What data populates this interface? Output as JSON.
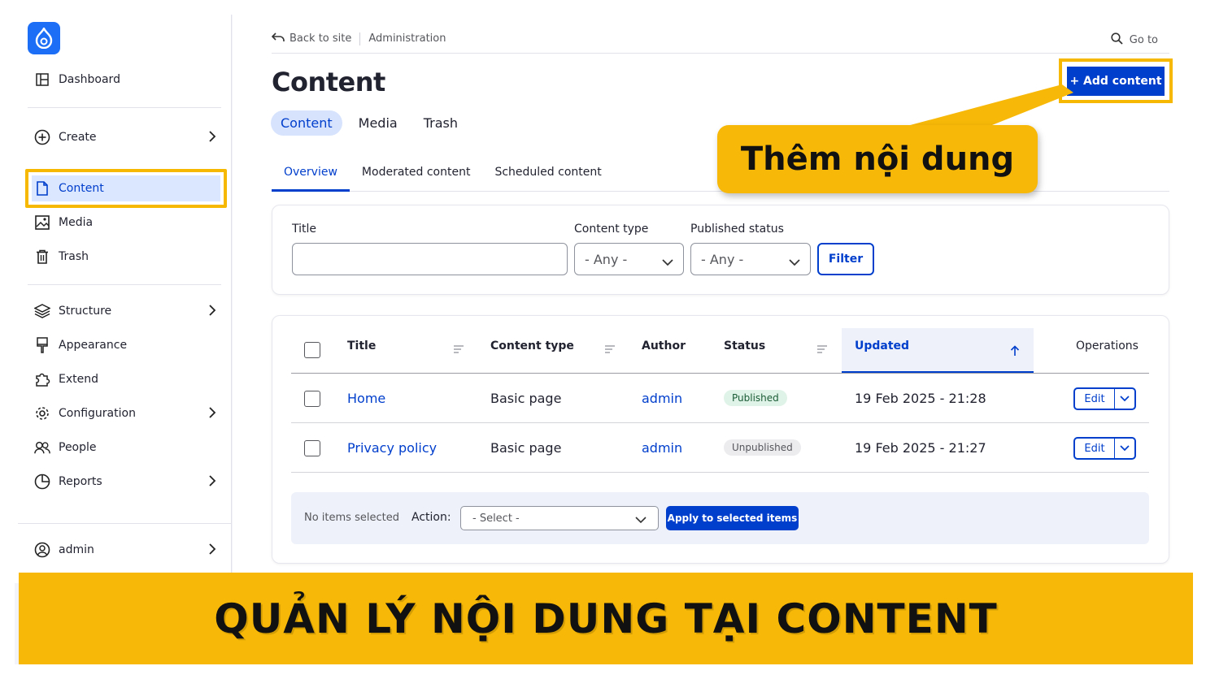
{
  "breadcrumb": {
    "back": "Back to site",
    "admin": "Administration",
    "goto": "Go to"
  },
  "sidebar": {
    "items": [
      {
        "label": "Dashboard",
        "icon": "dashboard-icon"
      },
      {
        "label": "Create",
        "icon": "plus-circle-icon"
      },
      {
        "label": "Content",
        "icon": "file-icon",
        "active": true
      },
      {
        "label": "Media",
        "icon": "image-icon"
      },
      {
        "label": "Trash",
        "icon": "trash-icon"
      },
      {
        "label": "Structure",
        "icon": "layers-icon"
      },
      {
        "label": "Appearance",
        "icon": "brush-icon"
      },
      {
        "label": "Extend",
        "icon": "puzzle-icon"
      },
      {
        "label": "Configuration",
        "icon": "gear-icon"
      },
      {
        "label": "People",
        "icon": "people-icon"
      },
      {
        "label": "Reports",
        "icon": "pie-chart-icon"
      },
      {
        "label": "admin",
        "icon": "user-circle-icon"
      }
    ]
  },
  "page": {
    "title": "Content",
    "add_button": "+ Add content"
  },
  "tabs_primary": [
    "Content",
    "Media",
    "Trash"
  ],
  "tabs_secondary": [
    "Overview",
    "Moderated content",
    "Scheduled content"
  ],
  "callout": "Thêm nội dung",
  "filters": {
    "title_label": "Title",
    "title_value": "",
    "type_label": "Content type",
    "type_value": "- Any -",
    "status_label": "Published status",
    "status_value": "- Any -",
    "button": "Filter"
  },
  "table": {
    "headers": [
      "Title",
      "Content type",
      "Author",
      "Status",
      "Updated",
      "Operations"
    ],
    "rows": [
      {
        "title": "Home",
        "type": "Basic page",
        "author": "admin",
        "status": "Published",
        "updated": "19 Feb 2025 - 21:28",
        "op": "Edit"
      },
      {
        "title": "Privacy policy",
        "type": "Basic page",
        "author": "admin",
        "status": "Unpublished",
        "updated": "19 Feb 2025 - 21:27",
        "op": "Edit"
      }
    ]
  },
  "bulk": {
    "selected": "No items selected",
    "action_label": "Action:",
    "select_value": "- Select -",
    "apply": "Apply to selected items"
  },
  "banner": "QUẢN LÝ NỘI DUNG TẠI CONTENT",
  "colors": {
    "accent": "#003ecc",
    "highlight": "#f7b807"
  }
}
